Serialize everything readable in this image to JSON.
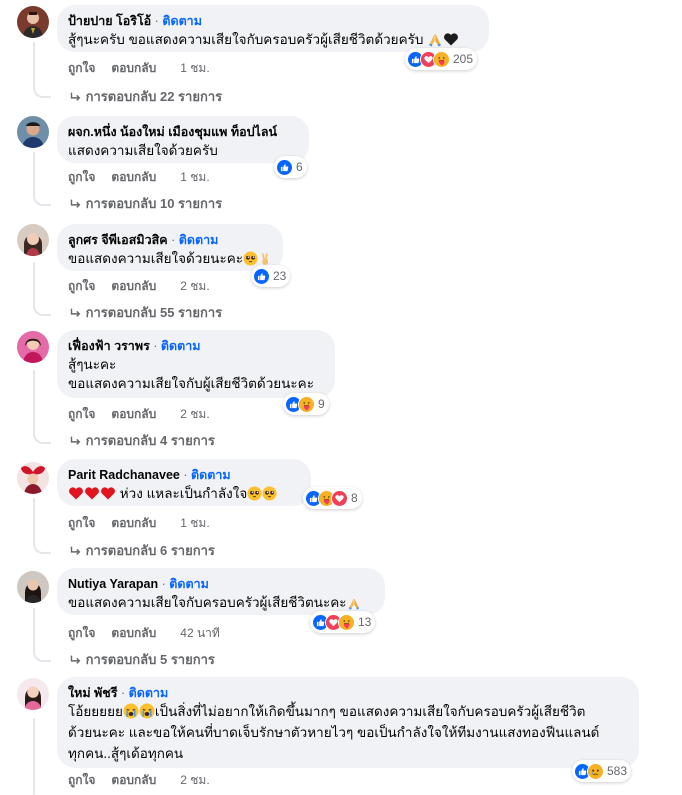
{
  "comments": [
    {
      "author": "ป้ายปาย โอริโอ้",
      "follow": "ติดตาม",
      "text": "สู้ๆนะครับ ขอแสดงความเสียใจกับครอบครัวผู้เสียชีวิตด้วยครับ",
      "reaction_count": "205",
      "like": "ถูกใจ",
      "reply": "ตอบกลับ",
      "time": "1 ชม.",
      "replies": "การตอบกลับ 22 รายการ"
    },
    {
      "author": "ผจก.หนึ่ง น้องใหม่ เมืองชุมแพ ท็อปไลน์",
      "follow": "",
      "text": "แสดงความเสียใจด้วยครับ",
      "reaction_count": "6",
      "like": "ถูกใจ",
      "reply": "ตอบกลับ",
      "time": "1 ชม.",
      "replies": "การตอบกลับ 10 รายการ"
    },
    {
      "author": "ลูกศร จีพีเอสมิวสิค",
      "follow": "ติดตาม",
      "text": "ขอแสดงความเสียใจด้วยนะคะ",
      "reaction_count": "23",
      "like": "ถูกใจ",
      "reply": "ตอบกลับ",
      "time": "2 ชม.",
      "replies": "การตอบกลับ 55 รายการ"
    },
    {
      "author": "เฟื่องฟ้า วราพร",
      "follow": "ติดตาม",
      "text_line1": "สู้ๆนะคะ",
      "text_line2": "ขอแสดงความเสียใจกับผู้เสียชีวิตด้วยนะคะ",
      "reaction_count": "9",
      "like": "ถูกใจ",
      "reply": "ตอบกลับ",
      "time": "2 ชม.",
      "replies": "การตอบกลับ 4 รายการ"
    },
    {
      "author": "Parit Radchanavee",
      "follow": "ติดตาม",
      "text": "ห่วง แหละเป็นกำลังใจ",
      "reaction_count": "8",
      "like": "ถูกใจ",
      "reply": "ตอบกลับ",
      "time": "1 ชม.",
      "replies": "การตอบกลับ 6 รายการ"
    },
    {
      "author": "Nutiya Yarapan",
      "follow": "ติดตาม",
      "text": "ขอแสดงความเสียใจกับครอบครัวผู้เสียชีวิตนะคะ",
      "reaction_count": "13",
      "like": "ถูกใจ",
      "reply": "ตอบกลับ",
      "time": "42 นาที",
      "replies": "การตอบกลับ 5 รายการ"
    },
    {
      "author": "ใหม่ พัชรี",
      "follow": "ติดตาม",
      "text_line1": "โอ้ยยยยย",
      "text_line1b": "เป็นสิ่งที่ไม่อยากให้เกิดขึ้นมากๆ ขอแสดงความเสียใจกับครอบครัวผู้เสียชีวิต",
      "text_line2": "ด้วยนะคะ และขอให้คนที่บาดเจ็บรักษาตัวหายไวๆ ขอเป็นกำลังใจให้ทีมงานแสงทองฟีนแลนด์",
      "text_line3": "ทุกคน..สู้ๆเด้อทุกคน",
      "reaction_count": "583",
      "like": "ถูกใจ",
      "reply": "ตอบกลับ",
      "time": "2 ชม."
    }
  ],
  "colors": {
    "like": "#0866ff",
    "love": "#f33e58",
    "care": "#f7b125",
    "sad": "#f7b125",
    "bubble": "#f0f2f5"
  },
  "icons": [
    "like-icon",
    "love-icon",
    "care-icon",
    "sad-icon",
    "pray-icon",
    "black-heart-icon",
    "red-heart-icon",
    "pleading-face-icon",
    "crying-face-icon",
    "peace-hand-icon",
    "reply-arrow-icon"
  ]
}
